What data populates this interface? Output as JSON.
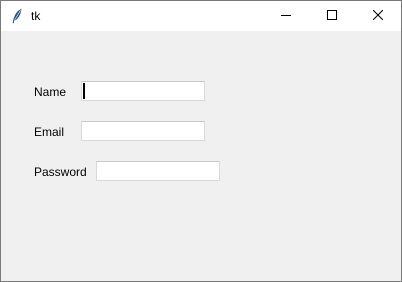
{
  "window": {
    "title": "tk",
    "icons": {
      "app": "feather-icon",
      "minimize": "minimize-icon",
      "maximize": "maximize-icon",
      "close": "close-icon"
    }
  },
  "form": {
    "fields": [
      {
        "label": "Name",
        "value": "",
        "focused": true
      },
      {
        "label": "Email",
        "value": ""
      },
      {
        "label": "Password",
        "value": ""
      }
    ]
  }
}
